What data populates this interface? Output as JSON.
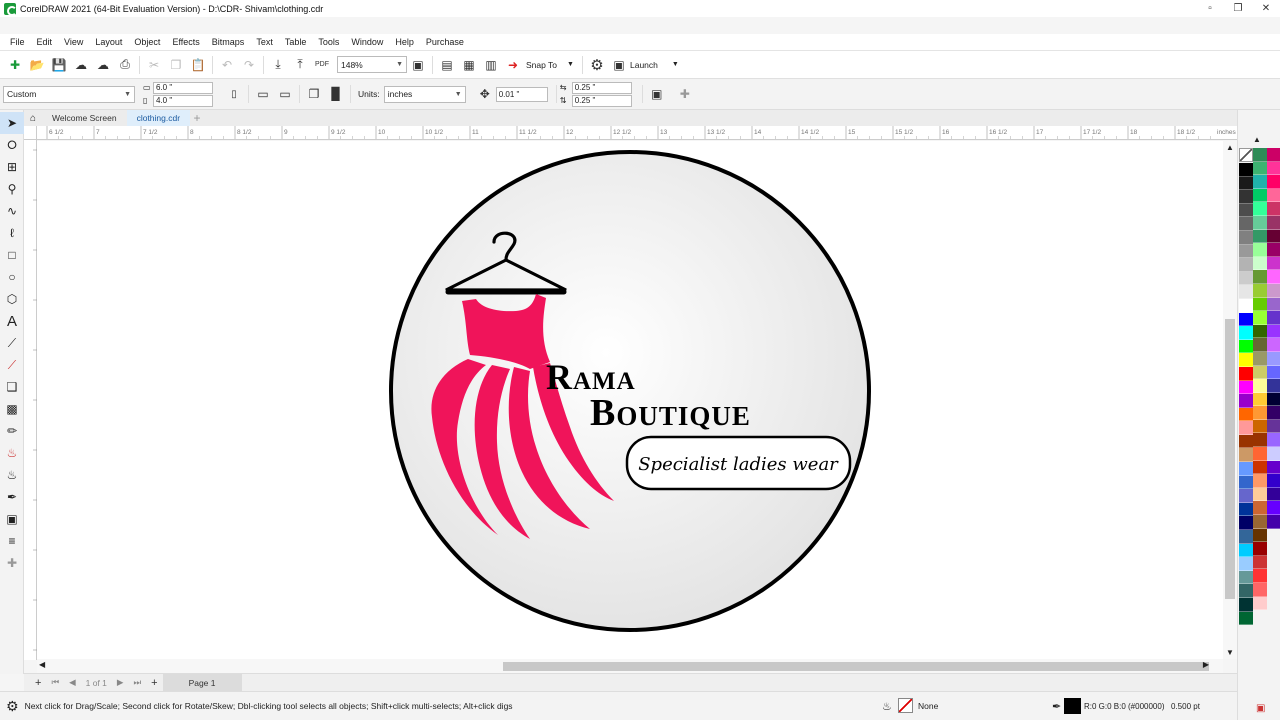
{
  "window": {
    "title": "CorelDRAW 2021 (64-Bit Evaluation Version) - D:\\CDR- Shivam\\clothing.cdr"
  },
  "menu": [
    "File",
    "Edit",
    "View",
    "Layout",
    "Object",
    "Effects",
    "Bitmaps",
    "Text",
    "Table",
    "Tools",
    "Window",
    "Help",
    "Purchase"
  ],
  "toolbar": {
    "zoom": "148%",
    "snap_label": "Snap To",
    "launch_label": "Launch",
    "pdf_label": "PDF"
  },
  "property_bar": {
    "preset": "Custom",
    "width": "6.0 \"",
    "height": "4.0 \"",
    "units_label": "Units:",
    "units_value": "inches",
    "nudge": "0.01 \"",
    "dup_x": "0.25 \"",
    "dup_y": "0.25 \""
  },
  "tabs": [
    {
      "label": "Welcome Screen"
    },
    {
      "label": "clothing.cdr"
    }
  ],
  "ruler": {
    "labels": [
      "6 1/2",
      "7",
      "7 1/2",
      "8",
      "8 1/2",
      "9",
      "9 1/2",
      "10",
      "10 1/2",
      "11",
      "11 1/2",
      "12",
      "12 1/2",
      "13",
      "13 1/2",
      "14",
      "14 1/2",
      "15",
      "15 1/2",
      "16",
      "16 1/2",
      "17",
      "17 1/2",
      "18",
      "18 1/2"
    ],
    "units": "inches"
  },
  "logo": {
    "line1": "Rama",
    "line2": "Boutique",
    "tagline": "Specialist ladies wear",
    "dress_color": "#f0145a",
    "ring_color": "#000000"
  },
  "page_nav": {
    "counter": "1 of 1",
    "page_tab": "Page 1"
  },
  "status": {
    "message": "Next click for Drag/Scale; Second click for Rotate/Skew; Dbl-clicking tool selects all objects; Shift+click multi-selects; Alt+click digs",
    "fill": "None",
    "outline_color": "R:0 G:0 B:0 (#000000)",
    "outline_width": "0.500 pt"
  },
  "palette": {
    "col1": [
      "#000000",
      "#1a1a1a",
      "#333333",
      "#4d4d4d",
      "#666666",
      "#808080",
      "#999999",
      "#b3b3b3",
      "#cccccc",
      "#e6e6e6",
      "#ffffff",
      "#0000ff",
      "#00ffff",
      "#00ff00",
      "#ffff00",
      "#ff0000",
      "#ff00ff",
      "#9900cc",
      "#ff6600",
      "#ff9999",
      "#993300",
      "#cc9966",
      "#6699ff",
      "#3366cc",
      "#6666cc",
      "#003399",
      "#000066",
      "#336699",
      "#00ccff",
      "#99ccff",
      "#669999",
      "#336666",
      "#003333",
      "#006633"
    ],
    "col2": [
      "#2e8b57",
      "#3cb371",
      "#20b2aa",
      "#00cc66",
      "#33ff99",
      "#66cc99",
      "#339966",
      "#99ff99",
      "#ccffcc",
      "#669933",
      "#99cc33",
      "#66cc00",
      "#99ff33",
      "#336600",
      "#666633",
      "#999966",
      "#cccc66",
      "#ffff99",
      "#ffcc33",
      "#ff9933",
      "#cc6600",
      "#993300",
      "#ff6633",
      "#cc3300",
      "#ff9966",
      "#ffcc99",
      "#cc6633",
      "#996633",
      "#663300",
      "#990000",
      "#cc3333",
      "#ff3333",
      "#ff6666",
      "#ffcccc"
    ],
    "col3": [
      "#cc0066",
      "#ff3399",
      "#ff0066",
      "#ff6699",
      "#cc3366",
      "#993366",
      "#660033",
      "#990066",
      "#cc33cc",
      "#ff66ff",
      "#cc99cc",
      "#9966cc",
      "#6633cc",
      "#9933ff",
      "#cc66ff",
      "#9999ff",
      "#6666ff",
      "#333399",
      "#000033",
      "#330066",
      "#663399",
      "#9966ff",
      "#ccccff",
      "#6600cc",
      "#3300cc",
      "#330099",
      "#6600ff",
      "#4400aa"
    ]
  }
}
